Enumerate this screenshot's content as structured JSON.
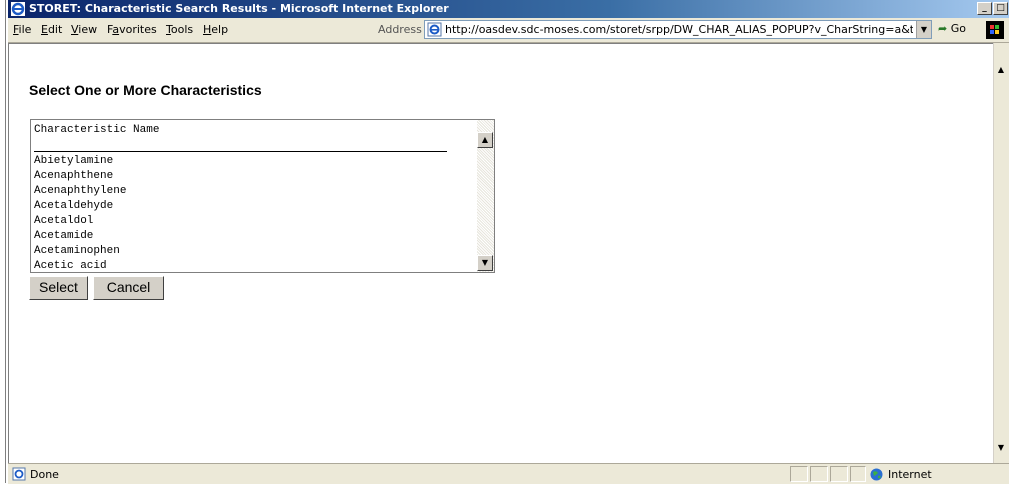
{
  "window": {
    "title": "STORET: Characteristic Search Results - Microsoft Internet Explorer",
    "minimize": "_",
    "restore": "□"
  },
  "menu": [
    {
      "label": "File",
      "key": "F",
      "rest": "ile"
    },
    {
      "label": "Edit",
      "key": "E",
      "rest": "dit"
    },
    {
      "label": "View",
      "key": "V",
      "rest": "iew"
    },
    {
      "label": "Favorites",
      "pre": "F",
      "key": "a",
      "rest": "vorites"
    },
    {
      "label": "Tools",
      "key": "T",
      "rest": "ools"
    },
    {
      "label": "Help",
      "key": "H",
      "rest": "elp"
    }
  ],
  "address": {
    "label": "Address",
    "url": "http://oasdev.sdc-moses.com/storet/srpp/DW_CHAR_ALIAS_POPUP?v_CharString=a&ta",
    "go_label": "Go"
  },
  "page": {
    "heading": "Select One or More Characteristics",
    "list_header": "Characteristic Name",
    "items": [
      "Abietylamine",
      "Acenaphthene",
      "Acenaphthylene",
      "Acetaldehyde",
      "Acetaldol",
      "Acetamide",
      "Acetaminophen",
      "Acetic acid"
    ],
    "select_label": "Select",
    "cancel_label": "Cancel"
  },
  "status": {
    "text": "Done",
    "zone": "Internet"
  },
  "colors": {
    "titlebar_start": "#0a246a",
    "titlebar_end": "#a6caf0",
    "chrome": "#ece9d8"
  }
}
